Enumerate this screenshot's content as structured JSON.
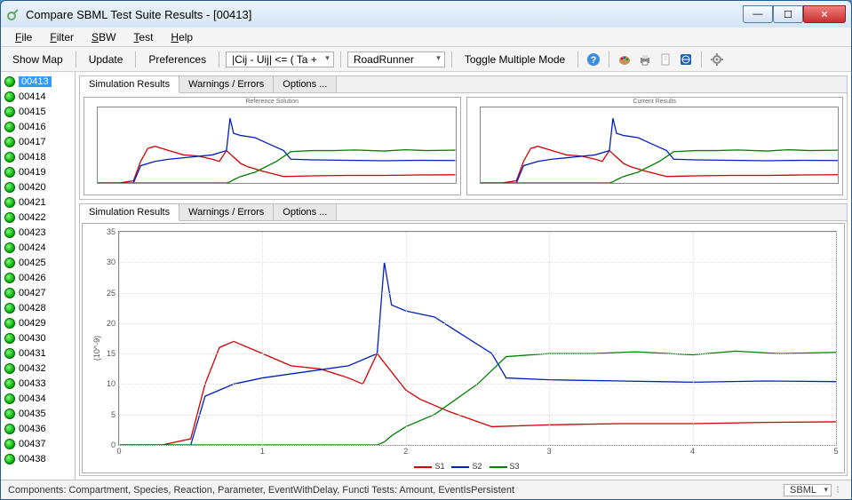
{
  "window": {
    "title": "Compare SBML Test Suite Results   -   [00413]"
  },
  "menu": {
    "items": [
      "File",
      "Filter",
      "SBW",
      "Test",
      "Help"
    ]
  },
  "toolbar": {
    "show_map": "Show Map",
    "update": "Update",
    "preferences": "Preferences",
    "formula": "|Cij - Uij| <= ( Ta +",
    "solver": "RoadRunner",
    "toggle": "Toggle Multiple Mode"
  },
  "sidebar": {
    "items": [
      "00413",
      "00414",
      "00415",
      "00416",
      "00417",
      "00418",
      "00419",
      "00420",
      "00421",
      "00422",
      "00423",
      "00424",
      "00425",
      "00426",
      "00427",
      "00428",
      "00429",
      "00430",
      "00431",
      "00432",
      "00433",
      "00434",
      "00435",
      "00436",
      "00437",
      "00438"
    ],
    "selected": "00413"
  },
  "tabs": {
    "sim": "Simulation Results",
    "warn": "Warnings / Errors",
    "opts": "Options ..."
  },
  "thumbs": {
    "left_title": "Reference Solution",
    "right_title": "Current Results"
  },
  "chart_data": {
    "type": "line",
    "ylabel": "(10^-9)",
    "xlim": [
      0,
      5
    ],
    "ylim": [
      0,
      35
    ],
    "xticks": [
      0,
      1,
      2,
      3,
      4,
      5
    ],
    "yticks": [
      0,
      5,
      10,
      15,
      20,
      25,
      30,
      35
    ],
    "series": [
      {
        "name": "S1",
        "color": "#d00000",
        "x": [
          0,
          0.3,
          0.5,
          0.6,
          0.7,
          0.8,
          1.0,
          1.2,
          1.4,
          1.6,
          1.7,
          1.8,
          1.9,
          2.0,
          2.1,
          2.3,
          2.6,
          3.0,
          3.5,
          4.0,
          4.5,
          5.0
        ],
        "y": [
          0,
          0,
          1,
          10,
          16,
          17,
          15,
          13,
          12.5,
          11,
          10,
          15,
          12,
          9,
          7.5,
          5.5,
          3,
          3.3,
          3.5,
          3.5,
          3.7,
          3.8
        ]
      },
      {
        "name": "S2",
        "color": "#0020c0",
        "x": [
          0,
          0.3,
          0.5,
          0.6,
          0.8,
          1.0,
          1.3,
          1.6,
          1.8,
          1.85,
          1.9,
          2.0,
          2.2,
          2.4,
          2.6,
          2.7,
          3.0,
          3.5,
          4.0,
          4.5,
          5.0
        ],
        "y": [
          0,
          0,
          0,
          8,
          10,
          11,
          12,
          13,
          15,
          30,
          23,
          22,
          21,
          18,
          15,
          11,
          10.7,
          10.5,
          10.3,
          10.5,
          10.4
        ]
      },
      {
        "name": "S3",
        "color": "#008000",
        "x": [
          0,
          0.5,
          1.0,
          1.5,
          1.8,
          1.85,
          1.9,
          2.0,
          2.2,
          2.5,
          2.7,
          3.0,
          3.3,
          3.6,
          4.0,
          4.3,
          4.6,
          5.0
        ],
        "y": [
          0,
          0,
          0,
          0,
          0,
          0.5,
          1.5,
          3,
          5,
          10,
          14.5,
          15,
          15,
          15.3,
          14.8,
          15.4,
          15,
          15.2
        ]
      }
    ]
  },
  "status": {
    "left": "Components: Compartment, Species, Reaction, Parameter, EventWithDelay, Functi Tests: Amount, EventIsPersistent",
    "right": "SBML"
  }
}
